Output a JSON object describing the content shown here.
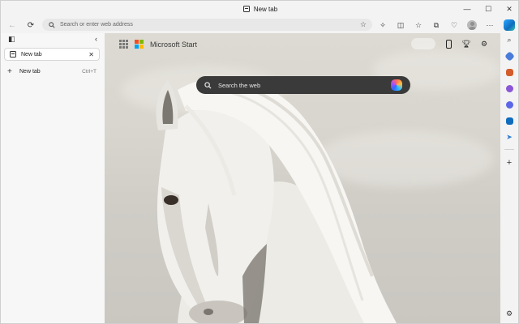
{
  "window": {
    "title": "New tab"
  },
  "address_bar": {
    "placeholder": "Search or enter web address"
  },
  "tabs_panel": {
    "tabs": [
      {
        "label": "New tab"
      }
    ],
    "new_tab": {
      "label": "New tab",
      "shortcut": "Ctrl+T"
    }
  },
  "new_tab_page": {
    "brand": "Microsoft Start",
    "search_placeholder": "Search the web"
  },
  "colors": {
    "microsoft_logo": [
      "#f25022",
      "#7fba00",
      "#00a4ef",
      "#ffb900"
    ],
    "search_box": "#3a3a3a"
  },
  "icons": {
    "title": "tab-icon",
    "back": "back-arrow-icon",
    "refresh": "refresh-icon",
    "search": "search-icon",
    "favorite": "star-icon",
    "sidebar": [
      "copilot-icon",
      "search-icon",
      "tag-icon",
      "briefcase-icon",
      "games-icon",
      "microsoft-365-icon",
      "outlook-icon",
      "send-icon",
      "add-icon",
      "settings-icon"
    ]
  }
}
